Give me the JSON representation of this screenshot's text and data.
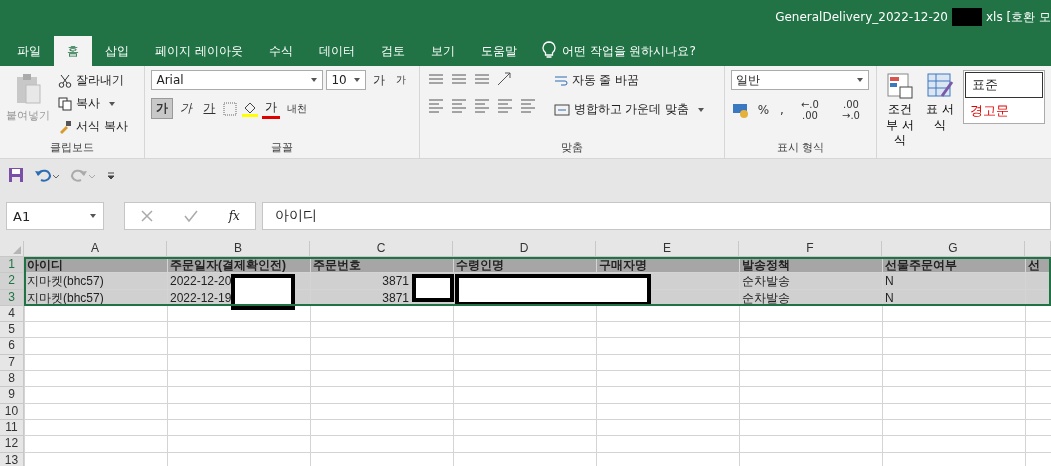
{
  "window": {
    "title_start": "GeneralDelivery_2022-12-20",
    "title_end": "xls  [호환 모"
  },
  "tabs": [
    {
      "label": "파일",
      "selected": false
    },
    {
      "label": "홈",
      "selected": true
    },
    {
      "label": "삽입",
      "selected": false
    },
    {
      "label": "페이지 레이아웃",
      "selected": false
    },
    {
      "label": "수식",
      "selected": false
    },
    {
      "label": "데이터",
      "selected": false
    },
    {
      "label": "검토",
      "selected": false
    },
    {
      "label": "보기",
      "selected": false
    },
    {
      "label": "도움말",
      "selected": false
    }
  ],
  "tell_me": "어떤 작업을 원하시나요?",
  "clipboard": {
    "paste": "붙여넣기",
    "cut": "잘라내기",
    "copy": "복사",
    "painter": "서식 복사",
    "label": "클립보드"
  },
  "font": {
    "name": "Arial",
    "size": "10",
    "grow": "가",
    "shrink": "가",
    "bold": "가",
    "italic": "가",
    "underline": "가",
    "color_letter": "가",
    "phonetic": "내천",
    "label": "글꼴"
  },
  "alignment": {
    "wrap": "자동 줄 바꿈",
    "merge": "병합하고 가운데 맞춤",
    "label": "맞춤"
  },
  "number": {
    "format": "일반",
    "percent": "%",
    "comma": ",",
    "inc": "←.0 .00",
    "dec": ".00 →.0",
    "label": "표시 형식"
  },
  "styles": {
    "conditional": "조건부 서식",
    "table": "표 서식",
    "normal": "표준",
    "warning": "경고문"
  },
  "name_box": "A1",
  "fx": "fx",
  "formula": "아이디",
  "columns": [
    "A",
    "B",
    "C",
    "D",
    "E",
    "F",
    "G"
  ],
  "rows": [
    {
      "number": "1",
      "kind": "header",
      "cells": {
        "A": {
          "text": "아이디"
        },
        "B": {
          "text": "주문일자(결제확인전)"
        },
        "C": {
          "text": "주문번호"
        },
        "D": {
          "text": "수령인명"
        },
        "E": {
          "text": "구매자명"
        },
        "F": {
          "text": "발송정책"
        },
        "G": {
          "text": "선물주문여부"
        },
        "H": {
          "text": "선"
        }
      }
    },
    {
      "number": "2",
      "kind": "data",
      "cells": {
        "A": {
          "text": "지마켓(bhc57)"
        },
        "B": {
          "text": "2022-12-20",
          "redacted": true
        },
        "C": {
          "text": "3871",
          "numeric": true,
          "redacted": true
        },
        "D": {
          "redacted": true
        },
        "F": {
          "text": "순차발송"
        },
        "G": {
          "text": "N"
        }
      }
    },
    {
      "number": "3",
      "kind": "data",
      "cells": {
        "A": {
          "text": "지마켓(bhc57)"
        },
        "B": {
          "text": "2022-12-19"
        },
        "C": {
          "text": "3871",
          "numeric": true
        },
        "F": {
          "text": "순차발송"
        },
        "G": {
          "text": "N"
        }
      }
    },
    {
      "number": "4",
      "kind": "empty"
    },
    {
      "number": "5",
      "kind": "empty"
    },
    {
      "number": "6",
      "kind": "empty"
    },
    {
      "number": "7",
      "kind": "empty"
    },
    {
      "number": "8",
      "kind": "empty"
    },
    {
      "number": "9",
      "kind": "empty"
    },
    {
      "number": "10",
      "kind": "empty"
    },
    {
      "number": "11",
      "kind": "empty"
    },
    {
      "number": "12",
      "kind": "empty"
    },
    {
      "number": "13",
      "kind": "empty"
    }
  ]
}
